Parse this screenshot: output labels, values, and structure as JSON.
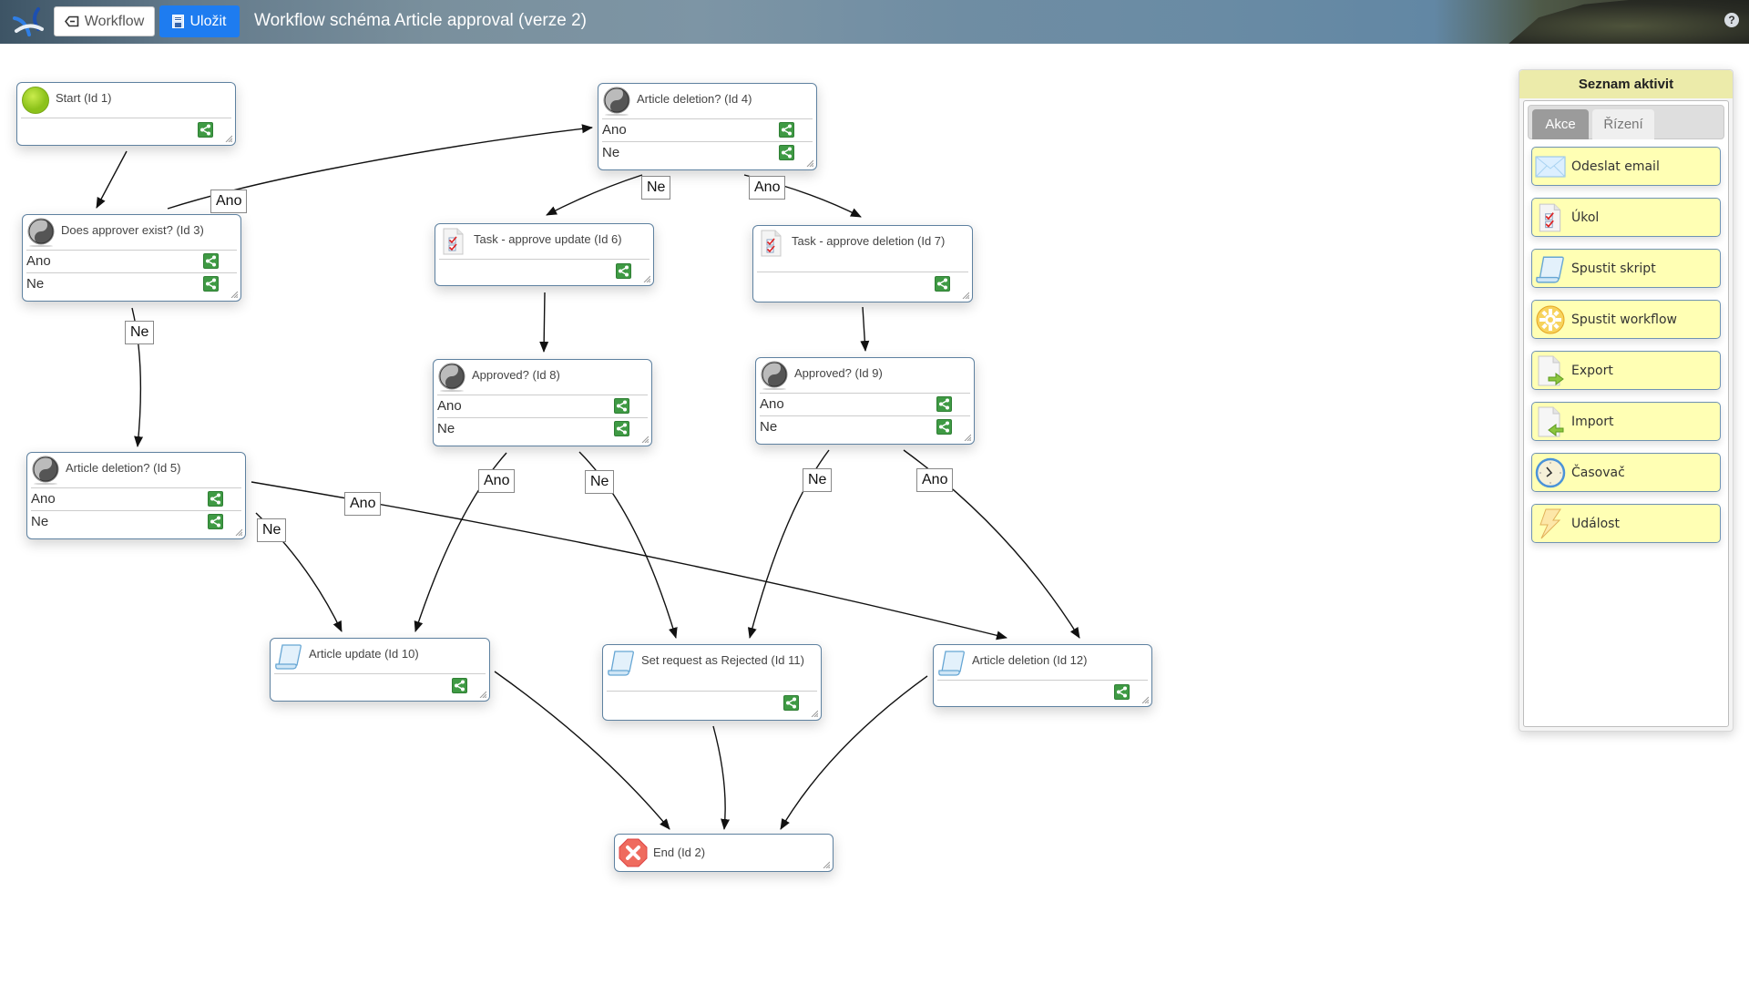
{
  "header": {
    "logo": "app-logo",
    "workflow_button": "Workflow",
    "save_button": "Uložit",
    "title": "Workflow schéma Article approval (verze 2)",
    "help": "?"
  },
  "nodes": [
    {
      "id": 1,
      "title": "Start (Id 1)",
      "kind": "start",
      "icon": "start-circle-icon",
      "outcomes": []
    },
    {
      "id": 3,
      "title": "Does approver exist? (Id 3)",
      "kind": "decision",
      "icon": "decision-icon",
      "outcomes": [
        "Ano",
        "Ne"
      ]
    },
    {
      "id": 4,
      "title": "Article deletion? (Id 4)",
      "kind": "decision",
      "icon": "decision-icon",
      "outcomes": [
        "Ano",
        "Ne"
      ]
    },
    {
      "id": 6,
      "title": "Task - approve update (Id 6)",
      "kind": "task",
      "icon": "task-icon",
      "outcomes": []
    },
    {
      "id": 7,
      "title": "Task - approve deletion (Id 7)",
      "kind": "task",
      "icon": "task-icon",
      "outcomes": []
    },
    {
      "id": 8,
      "title": "Approved? (Id 8)",
      "kind": "decision",
      "icon": "decision-icon",
      "outcomes": [
        "Ano",
        "Ne"
      ]
    },
    {
      "id": 9,
      "title": "Approved? (Id 9)",
      "kind": "decision",
      "icon": "decision-icon",
      "outcomes": [
        "Ano",
        "Ne"
      ]
    },
    {
      "id": 5,
      "title": "Article deletion? (Id 5)",
      "kind": "decision",
      "icon": "decision-icon",
      "outcomes": [
        "Ano",
        "Ne"
      ]
    },
    {
      "id": 10,
      "title": "Article update (Id 10)",
      "kind": "script",
      "icon": "script-icon",
      "outcomes": []
    },
    {
      "id": 11,
      "title": "Set request as Rejected (Id 11)",
      "kind": "script",
      "icon": "script-icon",
      "outcomes": []
    },
    {
      "id": 12,
      "title": "Article deletion (Id 12)",
      "kind": "script",
      "icon": "script-icon",
      "outcomes": []
    },
    {
      "id": 2,
      "title": "End (Id 2)",
      "kind": "end",
      "icon": "end-x-icon",
      "outcomes": []
    }
  ],
  "edges": [
    {
      "from": 1,
      "to": 3,
      "label": ""
    },
    {
      "from": 3,
      "to": 4,
      "label": "Ano"
    },
    {
      "from": 3,
      "to": 5,
      "label": "Ne"
    },
    {
      "from": 4,
      "to": 6,
      "label": "Ne"
    },
    {
      "from": 4,
      "to": 7,
      "label": "Ano"
    },
    {
      "from": 6,
      "to": 8,
      "label": ""
    },
    {
      "from": 7,
      "to": 9,
      "label": ""
    },
    {
      "from": 5,
      "to": 12,
      "label": "Ano"
    },
    {
      "from": 5,
      "to": 10,
      "label": "Ne"
    },
    {
      "from": 8,
      "to": 10,
      "label": "Ano"
    },
    {
      "from": 8,
      "to": 11,
      "label": "Ne"
    },
    {
      "from": 9,
      "to": 11,
      "label": "Ne"
    },
    {
      "from": 9,
      "to": 12,
      "label": "Ano"
    },
    {
      "from": 10,
      "to": 2,
      "label": ""
    },
    {
      "from": 11,
      "to": 2,
      "label": ""
    },
    {
      "from": 12,
      "to": 2,
      "label": ""
    }
  ],
  "palette": {
    "title": "Seznam aktivit",
    "tabs": [
      {
        "label": "Akce",
        "active": true
      },
      {
        "label": "Řízení",
        "active": false
      }
    ],
    "items": [
      {
        "label": "Odeslat email",
        "icon": "envelope-icon"
      },
      {
        "label": "Úkol",
        "icon": "task-icon"
      },
      {
        "label": "Spustit skript",
        "icon": "script-icon"
      },
      {
        "label": "Spustit workflow",
        "icon": "gear-icon"
      },
      {
        "label": "Export",
        "icon": "export-icon"
      },
      {
        "label": "Import",
        "icon": "import-icon"
      },
      {
        "label": "Časovač",
        "icon": "clock-icon"
      },
      {
        "label": "Událost",
        "icon": "lightning-icon"
      }
    ]
  },
  "colors": {
    "primary_button": "#1e7cf0",
    "node_border": "#5e81a0",
    "share_green": "#3f9a44",
    "palette_item_bg": "#ffffb4",
    "palette_title_bg": "#ecebaa"
  }
}
